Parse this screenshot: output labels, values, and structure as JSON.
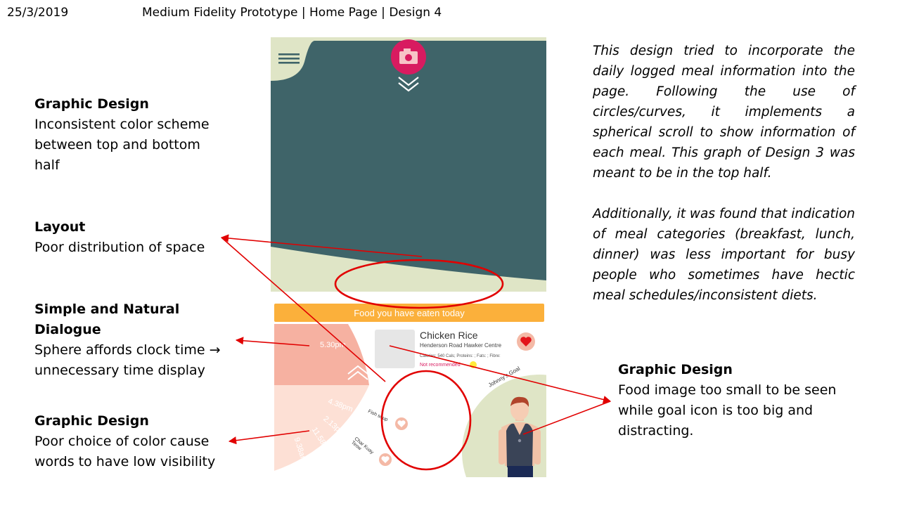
{
  "header": {
    "date": "25/3/2019",
    "title": "Medium Fidelity Prototype | Home Page | Design 4"
  },
  "annotations": [
    {
      "heading": "Graphic Design",
      "lines": [
        "Inconsistent color scheme",
        "between top and bottom",
        "half"
      ]
    },
    {
      "heading": "Layout",
      "lines": [
        "Poor distribution of space"
      ]
    },
    {
      "heading_lines": [
        "Simple and Natural",
        "Dialogue"
      ],
      "lines": [
        "Sphere affords clock time →",
        "unnecessary time display"
      ]
    },
    {
      "heading": "Graphic Design",
      "lines": [
        "Poor choice of color cause",
        "words to have low visibility"
      ]
    },
    {
      "heading": "Graphic Design",
      "lines": [
        "Food image too small to be seen",
        "while goal icon is too big and",
        "distracting."
      ]
    }
  ],
  "description": {
    "para1": "This design tried to incorporate the daily logged meal information into the page. Following the use of circles/curves, it implements a spherical scroll to show information of each meal. This graph of Design 3 was meant to be in the top half.",
    "para2": "Additionally, it was found that indication of meal categories (breakfast, lunch, dinner) was less important for busy people who sometimes have hectic meal schedules/inconsistent diets."
  },
  "prototype": {
    "banner": "Food you have eaten today",
    "meal_title": "Chicken Rice",
    "meal_location": "Henderson Road Hawker Centre",
    "meal_nutrition": "Calories: 540 Cals; Proteins: ; Fats: ; Fibre:",
    "meal_tag": "Not recommended",
    "goal_label": "Johnny's Goal",
    "times": [
      "5.30pm",
      "4.38pm",
      "2.13pm",
      "11.58am",
      "9.38am"
    ],
    "items": [
      "Fish soup",
      "Char Kuay Teow"
    ],
    "colors": {
      "top_panel": "#3f6469",
      "cream": "#dfe5c6",
      "banner": "#fbb03b",
      "camera": "#d81b60",
      "wheel_dark": "#f6b1a1",
      "wheel_light": "#fde0d5",
      "annotation": "#e10000"
    }
  }
}
